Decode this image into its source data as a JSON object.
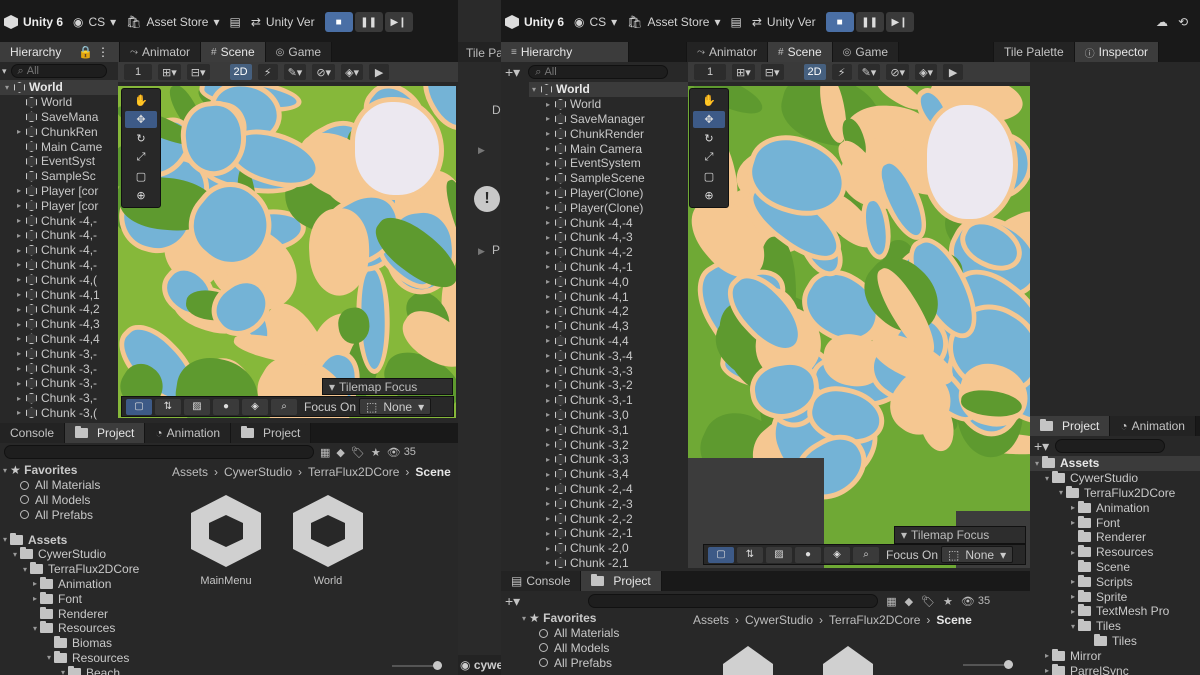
{
  "left": {
    "topbar": {
      "app": "Unity 6",
      "account": "CS",
      "asset_store": "Asset Store",
      "version": "Unity Ver"
    },
    "tabs_top": [
      "Hierarchy",
      "Animator",
      "Scene",
      "Game",
      "Tile Pa"
    ],
    "scene_toolbar": {
      "zoom": "1",
      "mode_2d": "2D"
    },
    "hierarchy": {
      "search_placeholder": "All",
      "root": "World",
      "items": [
        "World",
        "SaveMana",
        "ChunkRen",
        "Main Came",
        "EventSyst",
        "SampleSc",
        "Player [cor",
        "Player [cor",
        "Chunk -4,-",
        "Chunk -4,-",
        "Chunk -4,-",
        "Chunk -4,-",
        "Chunk -4,(",
        "Chunk -4,1",
        "Chunk -4,2",
        "Chunk -4,3",
        "Chunk -4,4",
        "Chunk -3,-",
        "Chunk -3,-",
        "Chunk -3,-",
        "Chunk -3,-",
        "Chunk -3,("
      ]
    },
    "tilemap_focus": {
      "title": "Tilemap Focus",
      "focus_on": "Focus On",
      "value": "None"
    },
    "tabs_bottom": [
      "Console",
      "Project",
      "Animation",
      "Project"
    ],
    "project": {
      "badge_count": "35",
      "favorites_title": "Favorites",
      "favorites": [
        "All Materials",
        "All Models",
        "All Prefabs"
      ],
      "assets_title": "Assets",
      "tree": [
        "CywerStudio",
        "TerraFlux2DCore",
        "Animation",
        "Font",
        "Renderer",
        "Resources",
        "Biomas",
        "Resources",
        "Beach"
      ],
      "breadcrumb": [
        "Assets",
        "CywerStudio",
        "TerraFlux2DCore",
        "Scene"
      ],
      "files": [
        "MainMenu",
        "World"
      ]
    }
  },
  "middle": {
    "inspector_letters": [
      "D",
      "P"
    ],
    "user": "cywe"
  },
  "right": {
    "topbar": {
      "app": "Unity 6",
      "account": "CS",
      "asset_store": "Asset Store",
      "version": "Unity Ver"
    },
    "tabs_top": [
      "Hierarchy",
      "Animator",
      "Scene",
      "Game",
      "Tile Palette",
      "Inspector"
    ],
    "scene_toolbar": {
      "zoom": "1",
      "mode_2d": "2D"
    },
    "hierarchy": {
      "search_placeholder": "All",
      "root": "World",
      "items": [
        "World",
        "SaveManager",
        "ChunkRender",
        "Main Camera",
        "EventSystem",
        "SampleScene",
        "Player(Clone)",
        "Player(Clone)",
        "Chunk -4,-4",
        "Chunk -4,-3",
        "Chunk -4,-2",
        "Chunk -4,-1",
        "Chunk -4,0",
        "Chunk -4,1",
        "Chunk -4,2",
        "Chunk -4,3",
        "Chunk -4,4",
        "Chunk -3,-4",
        "Chunk -3,-3",
        "Chunk -3,-2",
        "Chunk -3,-1",
        "Chunk -3,0",
        "Chunk -3,1",
        "Chunk -3,2",
        "Chunk -3,3",
        "Chunk -3,4",
        "Chunk -2,-4",
        "Chunk -2,-3",
        "Chunk -2,-2",
        "Chunk -2,-1",
        "Chunk -2,0",
        "Chunk -2,1"
      ]
    },
    "tilemap_focus": {
      "title": "Tilemap Focus",
      "focus_on": "Focus On",
      "value": "None"
    },
    "tabs_bottom": [
      "Console",
      "Project"
    ],
    "project": {
      "badge_count": "35",
      "favorites_title": "Favorites",
      "favorites": [
        "All Materials",
        "All Models",
        "All Prefabs"
      ],
      "breadcrumb": [
        "Assets",
        "CywerStudio",
        "TerraFlux2DCore",
        "Scene"
      ]
    },
    "side_tabs": [
      "Project",
      "Animation"
    ],
    "side_tree": [
      "Assets",
      "CywerStudio",
      "TerraFlux2DCore",
      "Animation",
      "Font",
      "Renderer",
      "Resources",
      "Scene",
      "Scripts",
      "Sprite",
      "TextMesh Pro",
      "Tiles",
      "Tiles",
      "Mirror",
      "ParrelSync"
    ]
  },
  "colors": {
    "grass": "#86b83a",
    "dark_grass": "#5e9a2f",
    "water": "#74b3d6",
    "sand": "#f5c791",
    "snow": "#ece8f0",
    "accent": "#3d5a87"
  }
}
